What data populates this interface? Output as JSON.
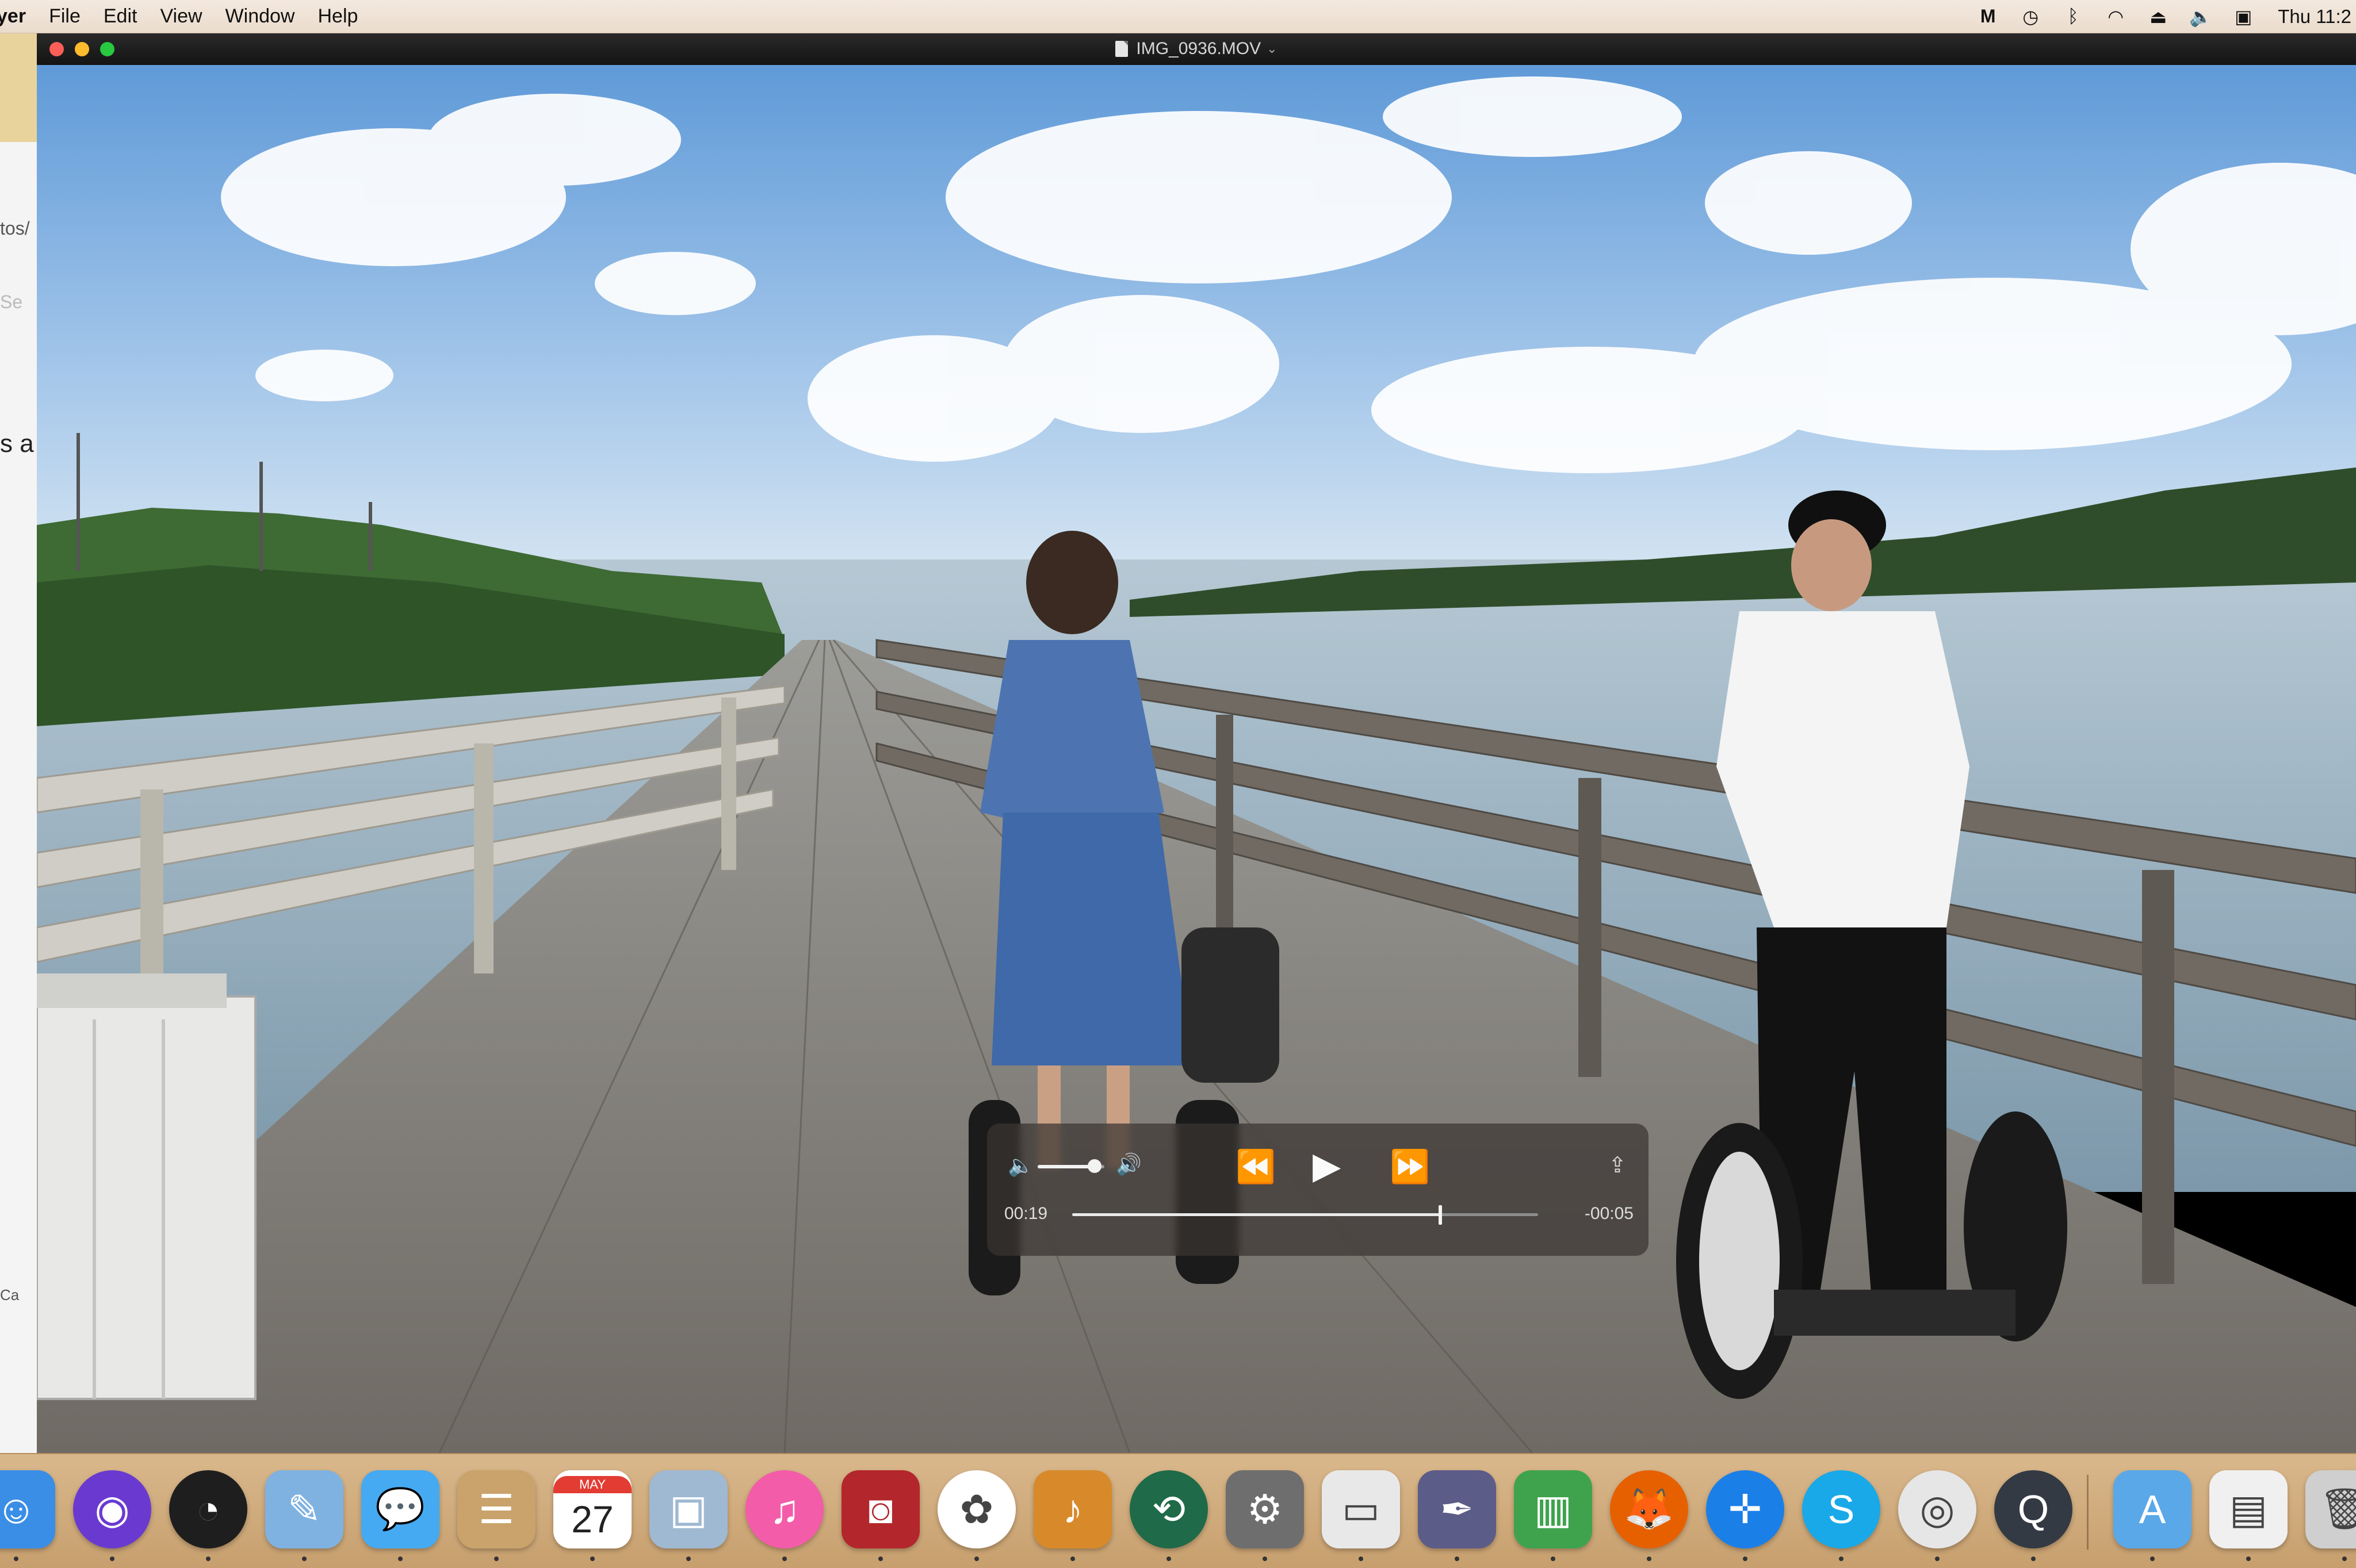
{
  "menubar": {
    "app_name": "yer",
    "menus": [
      "File",
      "Edit",
      "View",
      "Window",
      "Help"
    ],
    "clock": "Thu 11:2"
  },
  "background_window": {
    "fragments": [
      "tos/",
      "Se",
      "s a",
      "Ca"
    ]
  },
  "player": {
    "file_name": "IMG_0936.MOV",
    "elapsed": "00:19",
    "remaining": "-00:05",
    "progress": 0.79,
    "volume": 0.85,
    "icons": {
      "volume_low": "🔈",
      "volume_high": "🔊",
      "rewind": "⏪",
      "play": "▶",
      "fast_forward": "⏩",
      "share": "⇪"
    }
  },
  "dock": {
    "calendar": {
      "month": "MAY",
      "day": "27"
    },
    "apps": [
      {
        "name": "finder",
        "glyph": "☺",
        "color": "#3a8ee6"
      },
      {
        "name": "siri",
        "glyph": "◉",
        "color": "#6a3ad0"
      },
      {
        "name": "dashboard",
        "glyph": "◔",
        "color": "#1e1e1e"
      },
      {
        "name": "preview",
        "glyph": "✎",
        "color": "#7fb2e0"
      },
      {
        "name": "messages",
        "glyph": "💬",
        "color": "#45aaf2"
      },
      {
        "name": "contacts",
        "glyph": "☰",
        "color": "#c9a36b"
      },
      {
        "name": "calendar",
        "glyph": "",
        "color": "#ffffff"
      },
      {
        "name": "image-capture",
        "glyph": "▣",
        "color": "#9fb9d2"
      },
      {
        "name": "itunes",
        "glyph": "♫",
        "color": "#f35ca8"
      },
      {
        "name": "photo-booth",
        "glyph": "◙",
        "color": "#b3262b"
      },
      {
        "name": "photos",
        "glyph": "✿",
        "color": "#ffffff"
      },
      {
        "name": "garageband",
        "glyph": "♪",
        "color": "#d88a2a"
      },
      {
        "name": "time-machine",
        "glyph": "⟲",
        "color": "#1f6a48"
      },
      {
        "name": "system-preferences",
        "glyph": "⚙",
        "color": "#6e6e6e"
      },
      {
        "name": "keynote",
        "glyph": "▭",
        "color": "#e8e8e8"
      },
      {
        "name": "script-editor",
        "glyph": "✒",
        "color": "#5c5c88"
      },
      {
        "name": "numbers",
        "glyph": "▥",
        "color": "#3fa34d"
      },
      {
        "name": "firefox",
        "glyph": "🦊",
        "color": "#e66000"
      },
      {
        "name": "safari",
        "glyph": "✛",
        "color": "#1b7fe8"
      },
      {
        "name": "skype",
        "glyph": "S",
        "color": "#19a9e8"
      },
      {
        "name": "chrome",
        "glyph": "◎",
        "color": "#e6e6e6"
      },
      {
        "name": "quicktime",
        "glyph": "Q",
        "color": "#333a44"
      },
      {
        "name": "applications-folder",
        "glyph": "A",
        "color": "#5aa8e8"
      },
      {
        "name": "downloads",
        "glyph": "▤",
        "color": "#f0f0f0"
      },
      {
        "name": "trash",
        "glyph": "🗑",
        "color": "#cfcfcf"
      }
    ]
  }
}
